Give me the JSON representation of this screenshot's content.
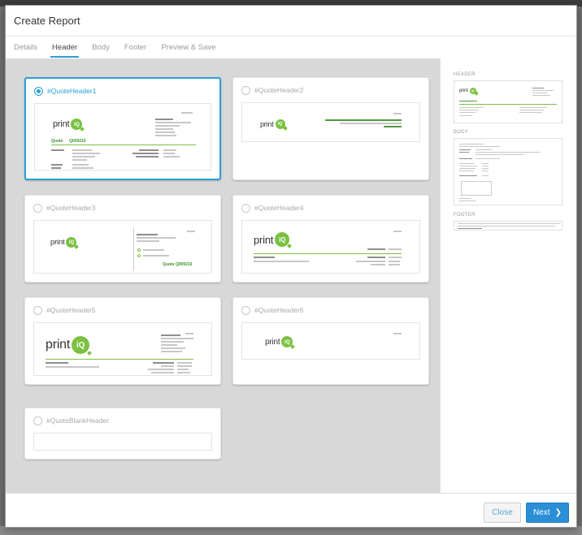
{
  "window": {
    "title": "Create Report"
  },
  "tabs": [
    {
      "label": "Details",
      "active": false
    },
    {
      "label": "Header",
      "active": true
    },
    {
      "label": "Body",
      "active": false
    },
    {
      "label": "Footer",
      "active": false
    },
    {
      "label": "Preview & Save",
      "active": false
    }
  ],
  "templates": [
    {
      "name": "#QuoteHeader1",
      "selected": true
    },
    {
      "name": "#QuoteHeader2",
      "selected": false
    },
    {
      "name": "#QuoteHeader3",
      "selected": false
    },
    {
      "name": "#QuoteHeader4",
      "selected": false
    },
    {
      "name": "#QuoteHeader5",
      "selected": false
    },
    {
      "name": "#QuoteHeader6",
      "selected": false
    },
    {
      "name": "#QuoteBlankHeader",
      "selected": false
    }
  ],
  "logo": {
    "text": "print",
    "badge": "iQ"
  },
  "preview": {
    "quote_label": "Quote",
    "quote_number": "Q009210",
    "quote_combined": "Quote Q009210"
  },
  "sidebar": {
    "header_label": "HEADER",
    "body_label": "BODY",
    "footer_label": "FOOTER"
  },
  "buttons": {
    "close": "Close",
    "next": "Next"
  },
  "colors": {
    "accent": "#2a9fd6",
    "brand_green": "#7cc142",
    "primary_button": "#2a8fd6"
  }
}
